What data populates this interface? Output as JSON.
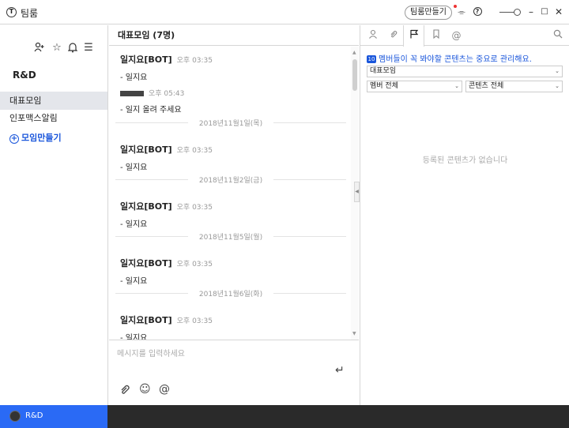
{
  "app": {
    "title": "팀룸",
    "logo": "T"
  },
  "titlebar": {
    "make_team_label": "팀룸만들기"
  },
  "sidebar": {
    "team_name": "R&D",
    "items": [
      {
        "label": "대표모임",
        "active": true
      },
      {
        "label": "인포맥스알림",
        "active": false
      }
    ],
    "add_label": "모임만들기"
  },
  "bottom": {
    "team_label": "R&D"
  },
  "chat": {
    "title": "대표모임 (7명)",
    "placeholder": "메시지를 입력하세요",
    "messages": [
      {
        "sender": "일지요[BOT]",
        "time": "오후 03:35",
        "body": "- 일지요"
      },
      {
        "sender": "",
        "time": "오후 05:43",
        "body": "- 일지 올려 주세요"
      },
      {
        "sender": "일지요[BOT]",
        "time": "오후 03:35",
        "body": "- 일지요"
      },
      {
        "sender": "일지요[BOT]",
        "time": "오후 03:35",
        "body": "- 일지요"
      },
      {
        "sender": "일지요[BOT]",
        "time": "오후 03:35",
        "body": "- 일지요"
      },
      {
        "sender": "일지요[BOT]",
        "time": "오후 03:35",
        "body": "- 일지요"
      }
    ],
    "dates": [
      "2018년11월1일(목)",
      "2018년11월2일(금)",
      "2018년11월5일(월)",
      "2018년11월6일(화)"
    ]
  },
  "panel": {
    "notice": "멤버들이 꼭 봐야할 콘텐츠는 중요로 관리해요.",
    "notice_badge": "10",
    "group_select": "대표모임",
    "member_select": "멤버 전체",
    "content_select": "콘텐츠 전체",
    "empty": "등록된 콘텐츠가 없습니다"
  },
  "colors": {
    "accent": "#1a56db",
    "bottom_active": "#2a6af5",
    "bottom_bar": "#2a2a2a"
  },
  "icons": [
    "person-icon",
    "attachment-icon",
    "flag-icon",
    "bookmark-icon",
    "at-icon",
    "search-icon",
    "bell-icon",
    "help-icon",
    "star-icon",
    "menu-icon",
    "add-user-icon",
    "emoji-icon",
    "send-icon"
  ]
}
